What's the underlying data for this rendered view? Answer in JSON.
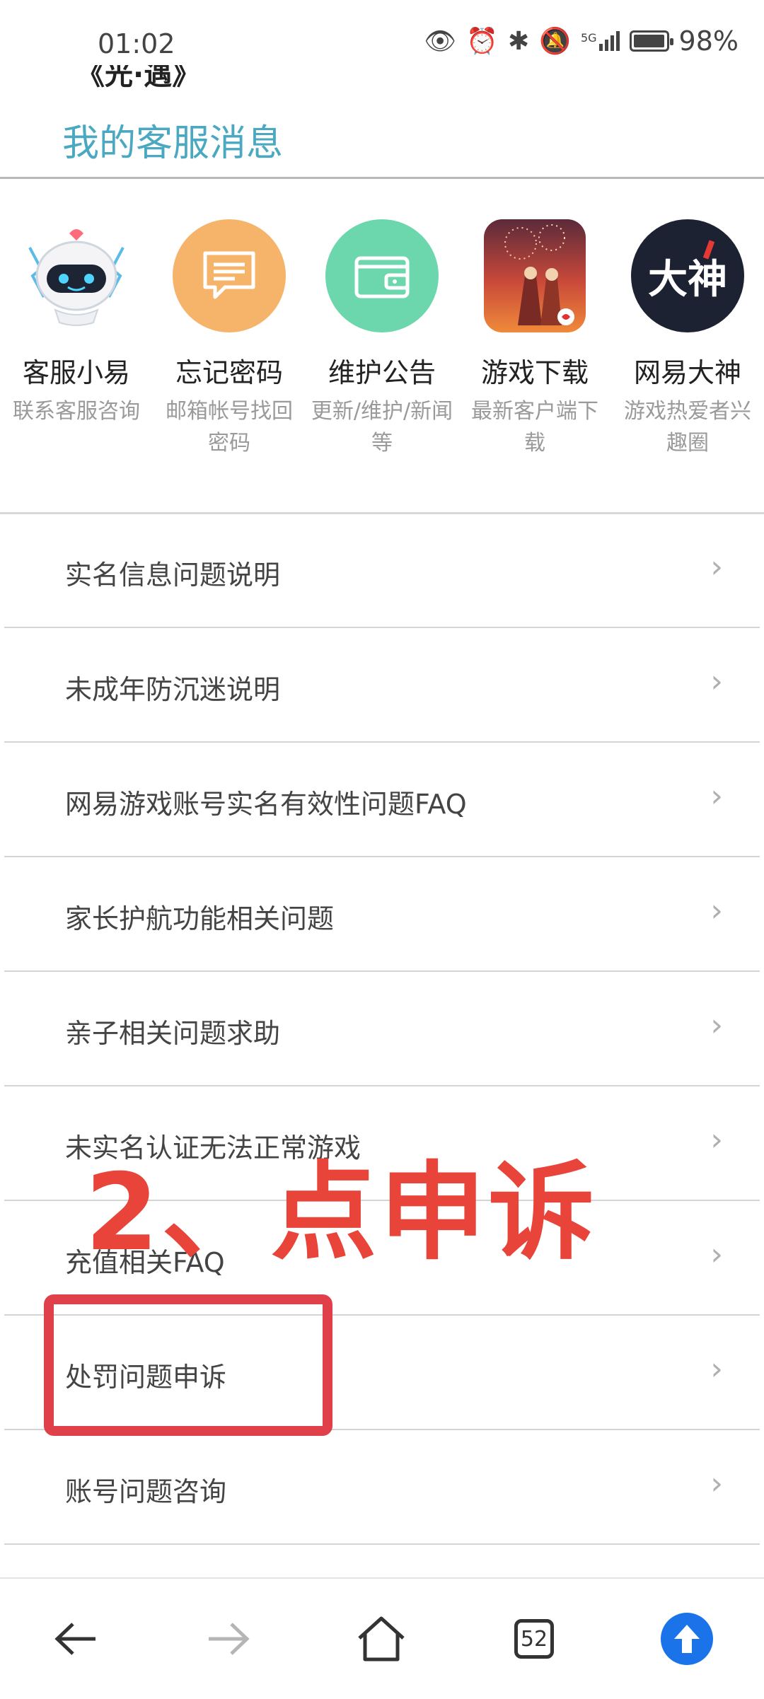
{
  "status_bar": {
    "time": "01:02",
    "signal_label": "5G",
    "battery_percent": "98%",
    "battery_level": 0.98
  },
  "header": {
    "truncated_title": "《光·遇》",
    "title": "我的客服消息"
  },
  "services": [
    {
      "name": "客服小易",
      "desc": "联系客服咨询",
      "icon": "robot-avatar-icon",
      "color": "#ffffff"
    },
    {
      "name": "忘记密码",
      "desc": "邮箱帐号找回密码",
      "icon": "message-icon",
      "color": "#f5b46a"
    },
    {
      "name": "维护公告",
      "desc": "更新/维护/新闻等",
      "icon": "wallet-icon",
      "color": "#6cd6ad"
    },
    {
      "name": "游戏下载",
      "desc": "最新客户端下载",
      "icon": "game-cover-icon",
      "color": "#e06a3a"
    },
    {
      "name": "网易大神",
      "desc": "游戏热爱者兴趣圈",
      "icon": "dashen-logo-icon",
      "color": "#1d2233",
      "logo_text": "大神"
    }
  ],
  "menu": [
    {
      "label": "实名信息问题说明"
    },
    {
      "label": "未成年防沉迷说明"
    },
    {
      "label": "网易游戏账号实名有效性问题FAQ"
    },
    {
      "label": "家长护航功能相关问题"
    },
    {
      "label": "亲子相关问题求助"
    },
    {
      "label": "未实名认证无法正常游戏"
    },
    {
      "label": "充值相关FAQ"
    },
    {
      "label": "处罚问题申诉"
    },
    {
      "label": "账号问题咨询"
    }
  ],
  "annotation": {
    "text": "2、点申诉"
  },
  "bottom_nav": {
    "tab_count": "52",
    "accent_color": "#1a73e8"
  }
}
